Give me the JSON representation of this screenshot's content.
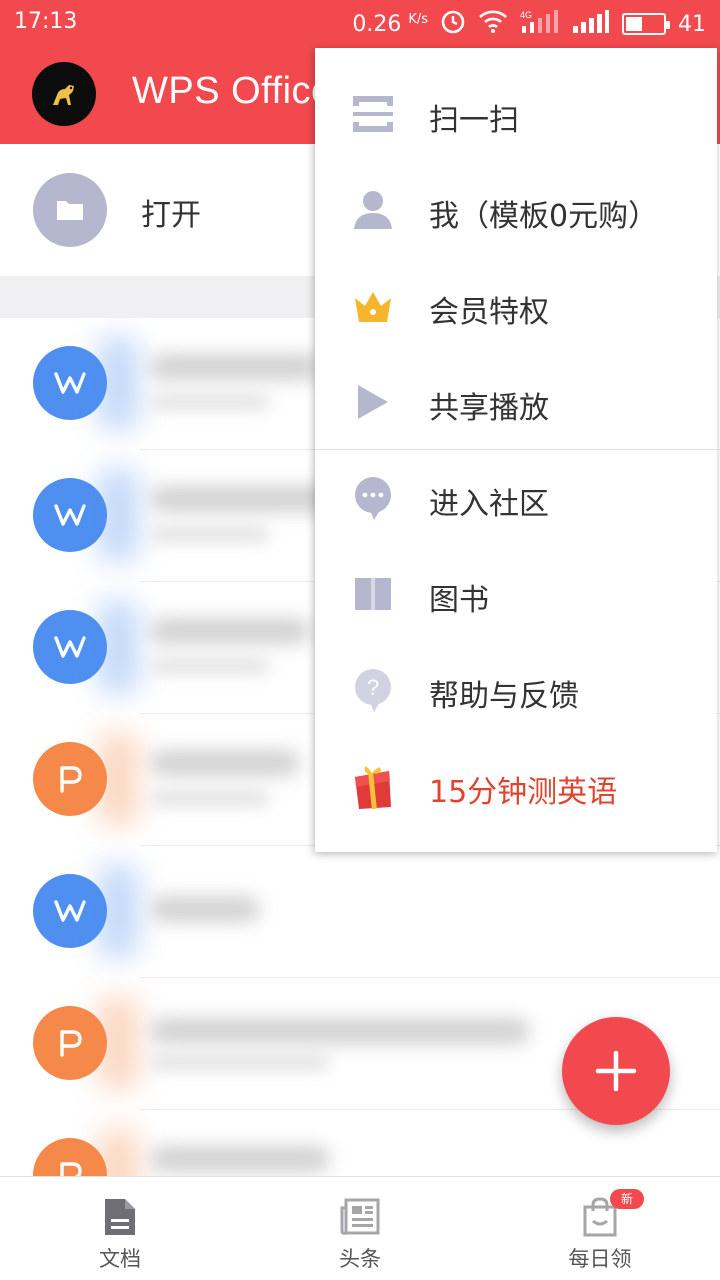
{
  "status_bar": {
    "time": "17:13",
    "speed_value": "0.26",
    "speed_unit": "K/s",
    "network": "4G",
    "battery": "41"
  },
  "app_bar": {
    "title": "WPS Office"
  },
  "open_row": {
    "label": "打开"
  },
  "files": [
    {
      "type": "W",
      "color": "#4e8ff0"
    },
    {
      "type": "W",
      "color": "#4e8ff0"
    },
    {
      "type": "W",
      "color": "#4e8ff0"
    },
    {
      "type": "P",
      "color": "#f5894a"
    },
    {
      "type": "W",
      "color": "#4e8ff0"
    },
    {
      "type": "P",
      "color": "#f5894a"
    },
    {
      "type": "P",
      "color": "#f5894a"
    }
  ],
  "menu": {
    "items": [
      {
        "label": "扫一扫",
        "icon": "scan-icon"
      },
      {
        "label": "我（模板0元购）",
        "icon": "user-icon"
      },
      {
        "label": "会员特权",
        "icon": "crown-icon"
      },
      {
        "label": "共享播放",
        "icon": "play-icon"
      },
      {
        "label": "进入社区",
        "icon": "chat-bubble-icon"
      },
      {
        "label": "图书",
        "icon": "book-icon"
      },
      {
        "label": "帮助与反馈",
        "icon": "help-icon"
      },
      {
        "label": "15分钟测英语",
        "icon": "gift-icon"
      }
    ]
  },
  "bottom_nav": {
    "items": [
      {
        "label": "文档",
        "icon": "document-icon"
      },
      {
        "label": "头条",
        "icon": "news-icon"
      },
      {
        "label": "每日领",
        "icon": "shopping-bag-icon",
        "badge": "新"
      }
    ]
  },
  "colors": {
    "brand_red": "#f1494e",
    "word_blue": "#4e8ff0",
    "ppt_orange": "#f5894a",
    "icon_gray": "#b5b7cf",
    "promo_red": "#e0442f"
  }
}
